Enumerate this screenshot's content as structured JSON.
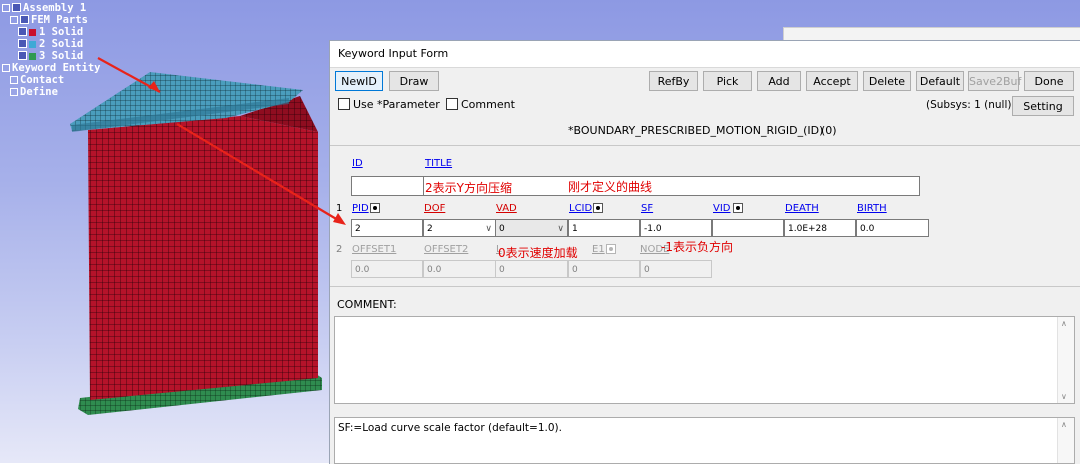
{
  "tree": {
    "items": [
      "Assembly 1",
      "FEM Parts",
      "1 Solid",
      "2 Solid",
      "3 Solid",
      "Keyword Entity",
      "Contact",
      "Define"
    ],
    "colors": [
      "#c8102e",
      "#3fa9d6",
      "#2f9a52"
    ]
  },
  "dialog": {
    "title": "Keyword Input Form",
    "toolbar": {
      "newid": "NewID",
      "draw": "Draw",
      "refby": "RefBy",
      "pick": "Pick",
      "add": "Add",
      "accept": "Accept",
      "delete": "Delete",
      "default": "Default",
      "save2buf": "Save2Buf",
      "done": "Done"
    },
    "use_parameter": "Use *Parameter",
    "comment_check": "Comment",
    "subsys": "(Subsys: 1 (null))",
    "setting": "Setting",
    "keyword": "*BOUNDARY_PRESCRIBED_MOTION_RIGID_(ID)",
    "count": "(0)",
    "id_label": "ID",
    "title_label": "TITLE",
    "row1_num": "1",
    "row2_num": "2",
    "row1_labels": [
      "PID",
      "DOF",
      "VAD",
      "LCID",
      "SF",
      "VID",
      "DEATH",
      "BIRTH"
    ],
    "row1_values": [
      "2",
      "2",
      "0",
      "1",
      "-1.0",
      "",
      "1.0E+28",
      "0.0"
    ],
    "row2_labels": [
      "OFFSET1",
      "OFFSET2",
      "L",
      "E1",
      "NODE"
    ],
    "row2_values": [
      "0.0",
      "0.0",
      "0",
      "0",
      "0"
    ],
    "comment_label": "COMMENT:",
    "help_text": "SF:=Load curve scale factor (default=1.0)."
  },
  "annotations": {
    "dof_note": "2表示Y方向压缩",
    "curve_note": "刚才定义的曲线",
    "vad_note": "0表示速度加载",
    "sf_note": "-1表示负方向"
  },
  "colors": {
    "accent_red": "#e00000",
    "link_blue": "#0000ee",
    "link_red": "#d40000"
  }
}
